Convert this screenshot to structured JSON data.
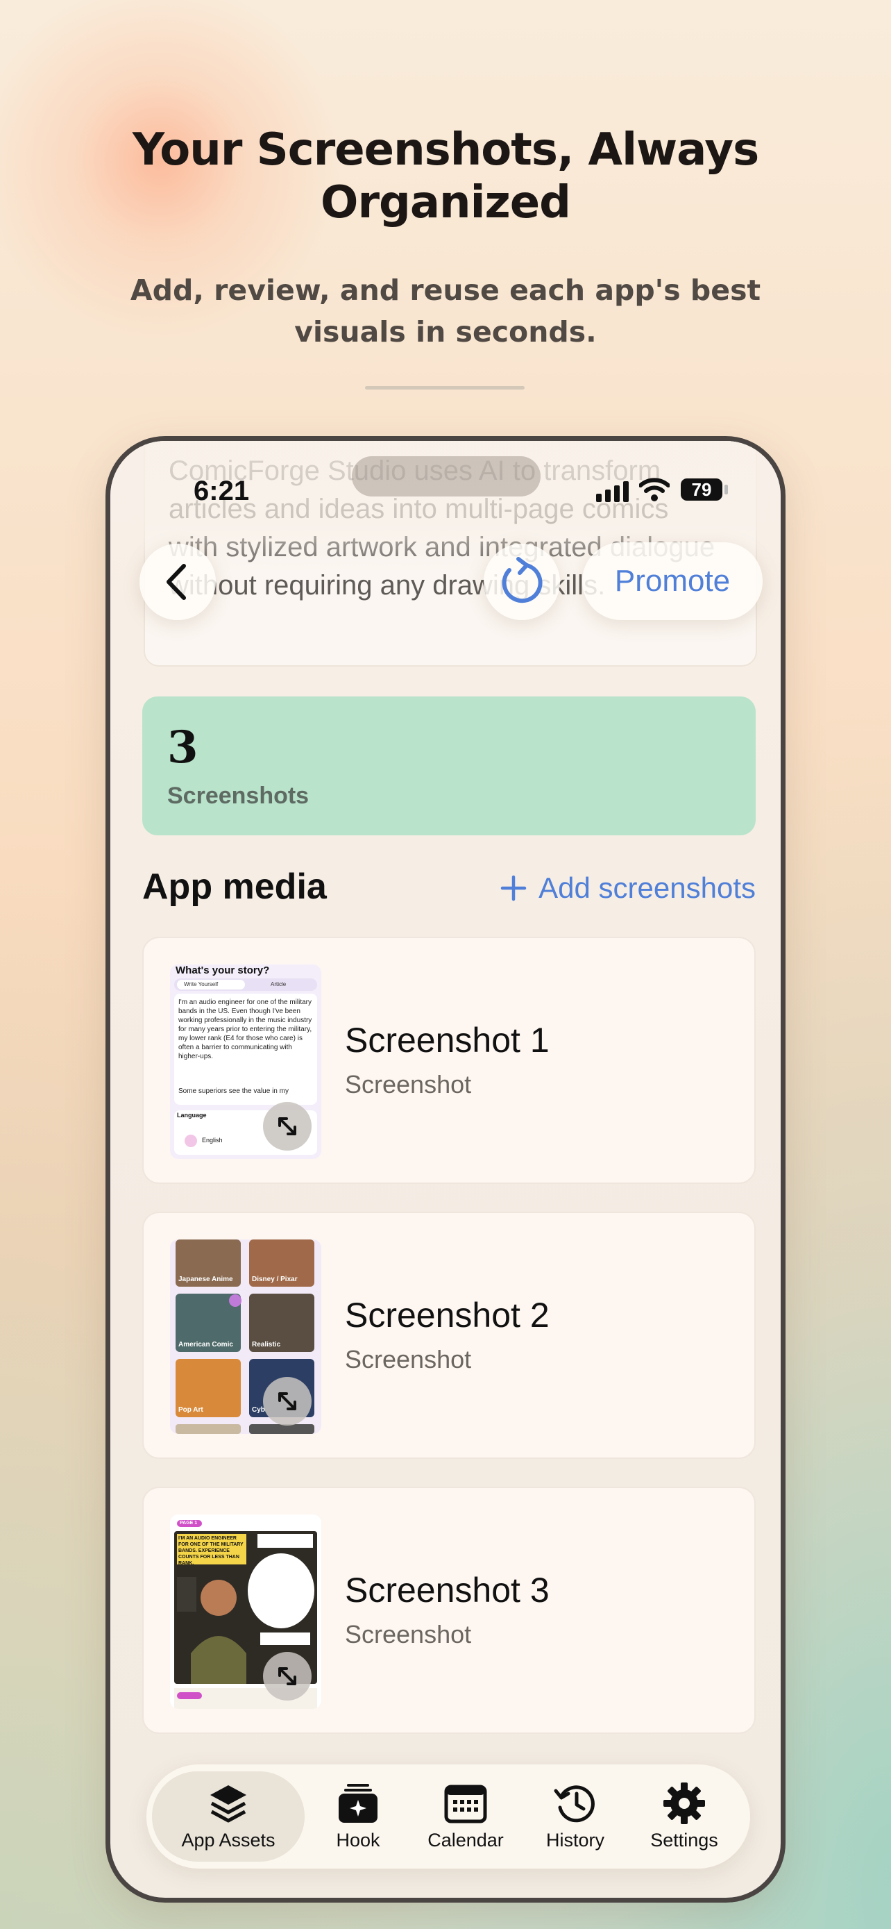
{
  "hero": {
    "title": "Your Screenshots, Always Organized",
    "subtitle": "Add, review, and reuse each app's best visuals in seconds."
  },
  "status_bar": {
    "time": "6:21",
    "battery": "79"
  },
  "app_description": "ComicForge Studio uses AI to transform articles and ideas into multi-page comics with stylized artwork and integrated dialogue without requiring any drawing skills.",
  "nav": {
    "promote_label": "Promote"
  },
  "stats": {
    "count": "3",
    "label": "Screenshots"
  },
  "media": {
    "title": "App media",
    "add_label": "Add screenshots",
    "items": [
      {
        "title": "Screenshot 1",
        "subtitle": "Screenshot"
      },
      {
        "title": "Screenshot 2",
        "subtitle": "Screenshot"
      },
      {
        "title": "Screenshot 3",
        "subtitle": "Screenshot"
      }
    ]
  },
  "thumbnails": {
    "t1": {
      "heading": "What's your story?",
      "tabs": [
        "Write Yourself",
        "Article"
      ],
      "body": "I'm an audio engineer for one of the military bands in the US. Even though I've been working professionally in the music industry for many years prior to entering the military, my lower rank (E4 for those who care) is often a barrier to communicating with higher-ups.",
      "body2": "Some superiors see the value in my",
      "language_label": "Language",
      "language_value": "English"
    },
    "t2": {
      "styles": [
        "Japanese Anime",
        "Disney / Pixar",
        "American Comic",
        "Realistic",
        "Pop Art",
        "Cyb"
      ]
    },
    "t3": {
      "page_badge": "PAGE 1",
      "caption": "I'M AN AUDIO ENGINEER FOR ONE OF THE MILITARY BANDS. EXPERIENCE COUNTS FOR LESS THAN RANK."
    }
  },
  "tabbar": {
    "items": [
      {
        "label": "App Assets",
        "icon": "layers-icon"
      },
      {
        "label": "Hook",
        "icon": "hook-icon"
      },
      {
        "label": "Calendar",
        "icon": "calendar-icon"
      },
      {
        "label": "History",
        "icon": "history-icon"
      },
      {
        "label": "Settings",
        "icon": "gear-icon"
      }
    ]
  },
  "colors": {
    "accent": "#4f7fd8",
    "stats_bg": "#b9e3cb"
  }
}
